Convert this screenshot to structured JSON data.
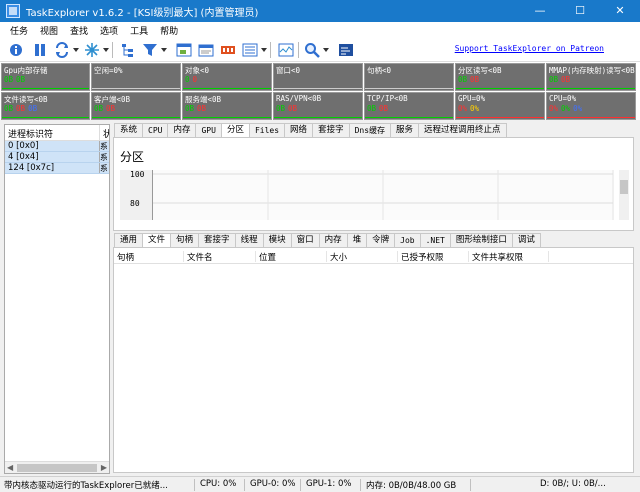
{
  "window": {
    "title": "TaskExplorer v1.6.2 - [KSI级别最大] (内置管理员)"
  },
  "menu": [
    "任务",
    "视图",
    "查找",
    "选项",
    "工具",
    "帮助"
  ],
  "toolbar": {
    "support_link": "Support TaskExplorer on Patreon"
  },
  "graphs": [
    {
      "label": "Gpu内部存储",
      "values": [
        "0B",
        "0B"
      ],
      "colors": [
        "#00d000",
        "#00d000"
      ]
    },
    {
      "label": "空闲=0%",
      "values": [],
      "colors": []
    },
    {
      "label": "对象<0",
      "values": [
        "0",
        "0"
      ],
      "colors": [
        "#00d000",
        "#ff3030"
      ]
    },
    {
      "label": "窗口<0",
      "values": [],
      "colors": []
    },
    {
      "label": "句柄<0",
      "values": [],
      "colors": []
    },
    {
      "label": "分区读写<0B",
      "values": [
        "0B",
        "0B"
      ],
      "colors": [
        "#00d000",
        "#ff3030"
      ]
    },
    {
      "label": "MMAP(内存映射)读写<0B",
      "values": [
        "0B",
        "0B"
      ],
      "colors": [
        "#00d000",
        "#ff3030"
      ]
    },
    {
      "label": "文件读写<0B",
      "values": [
        "0B",
        "0B",
        "0B"
      ],
      "colors": [
        "#00d000",
        "#ff3030",
        "#4070ff"
      ]
    },
    {
      "label": "客户端<0B",
      "values": [
        "0B",
        "0B"
      ],
      "colors": [
        "#00d000",
        "#ff3030"
      ]
    },
    {
      "label": "服务端<0B",
      "values": [
        "0B",
        "0B"
      ],
      "colors": [
        "#00d000",
        "#ff3030"
      ]
    },
    {
      "label": "RAS/VPN<0B",
      "values": [
        "0B",
        "0B"
      ],
      "colors": [
        "#00d000",
        "#ff3030"
      ]
    },
    {
      "label": "TCP/IP<0B",
      "values": [
        "0B",
        "0B"
      ],
      "colors": [
        "#00d000",
        "#ff3030"
      ]
    },
    {
      "label": "GPU=0%",
      "values": [
        "0%",
        "0%"
      ],
      "colors": [
        "#ff3030",
        "#ffd000"
      ]
    },
    {
      "label": "CPU=0%",
      "values": [
        "0%",
        "0%",
        "0%"
      ],
      "colors": [
        "#ff3030",
        "#00d000",
        "#4070ff"
      ]
    }
  ],
  "left_panel": {
    "columns": [
      "进程标识符",
      "状"
    ],
    "rows": [
      {
        "pid": "0 [0x0]",
        "status": "系"
      },
      {
        "pid": "4 [0x4]",
        "status": "系"
      },
      {
        "pid": "124 [0x7c]",
        "status": "系"
      }
    ]
  },
  "top_tabs": [
    {
      "label": "系统",
      "mono": false
    },
    {
      "label": "CPU",
      "mono": true
    },
    {
      "label": "内存",
      "mono": false
    },
    {
      "label": "GPU",
      "mono": true
    },
    {
      "label": "分区",
      "mono": false,
      "active": true
    },
    {
      "label": "Files",
      "mono": true
    },
    {
      "label": "网络",
      "mono": false
    },
    {
      "label": "套接字",
      "mono": false
    },
    {
      "label": "Dns缓存",
      "mono": true
    },
    {
      "label": "服务",
      "mono": false
    },
    {
      "label": "远程过程调用终止点",
      "mono": false
    }
  ],
  "partition_view": {
    "title": "分区",
    "chart_data": {
      "type": "line",
      "y_ticks": [
        "100",
        "80"
      ],
      "series": []
    }
  },
  "bottom_tabs": [
    {
      "label": "通用",
      "mono": false
    },
    {
      "label": "文件",
      "mono": false,
      "active": true
    },
    {
      "label": "句柄",
      "mono": false
    },
    {
      "label": "套接字",
      "mono": false
    },
    {
      "label": "线程",
      "mono": false
    },
    {
      "label": "模块",
      "mono": false
    },
    {
      "label": "窗口",
      "mono": false
    },
    {
      "label": "内存",
      "mono": false
    },
    {
      "label": "堆",
      "mono": false
    },
    {
      "label": "令牌",
      "mono": false
    },
    {
      "label": "Job",
      "mono": true
    },
    {
      "label": ".NET",
      "mono": true
    },
    {
      "label": "图形绘制接口",
      "mono": false
    },
    {
      "label": "调试",
      "mono": false
    }
  ],
  "files_table": {
    "columns": [
      "句柄",
      "文件名",
      "位置",
      "大小",
      "已授予权限",
      "文件共享权限"
    ]
  },
  "status": {
    "message": "带内核态驱动运行的TaskExplorer已就绪...",
    "cpu": "CPU: 0%",
    "gpu0": "GPU-0: 0%",
    "gpu1": "GPU-1: 0%",
    "memory": "内存: 0B/0B/48.00 GB",
    "rest": "D: 0B/; U: 0B/..."
  }
}
